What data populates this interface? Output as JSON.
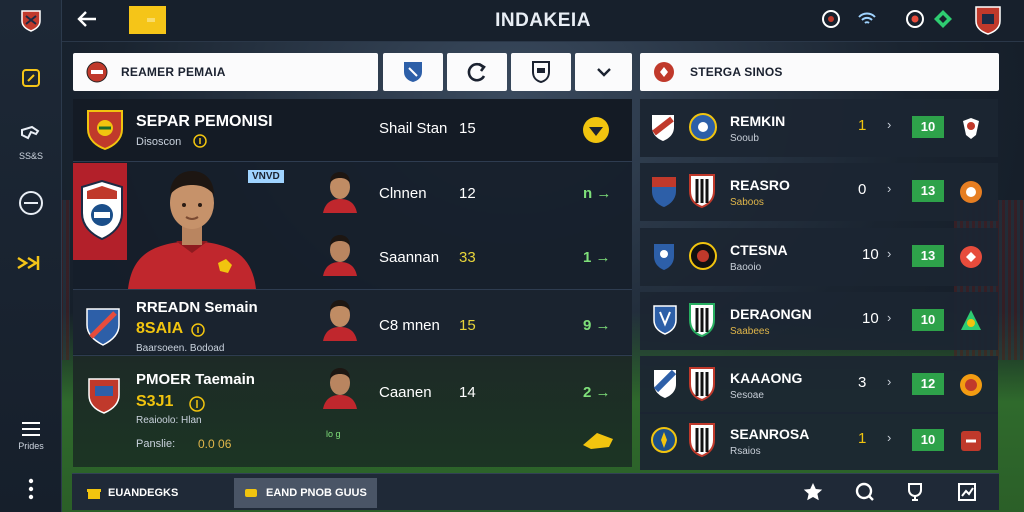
{
  "header": {
    "title": "INDAKEIA"
  },
  "rail": {
    "items": [
      {
        "label": ""
      },
      {
        "label": "SS&S"
      },
      {
        "label": ""
      },
      {
        "label": ""
      },
      {
        "label": "Prides"
      }
    ]
  },
  "filters": {
    "team_label": "REAMER PEMAIA",
    "right_label": "STERGA SINOS"
  },
  "squad": {
    "lead": {
      "name": "SEPAR PEMONISI",
      "sub": "Disoscon",
      "stat_name": "Shail Stan",
      "stat_value": "15"
    },
    "tag": "VNVD",
    "rows": [
      {
        "stat_name": "Clnnen",
        "value": "12",
        "trend": "n →",
        "value_yellow": false
      },
      {
        "stat_name": "Saannan",
        "value": "33",
        "trend": "1 →",
        "value_yellow": true
      },
      {
        "stat_name": "C8 mnen",
        "value": "15",
        "trend": "9 →",
        "value_yellow": true
      },
      {
        "stat_name": "Caanen",
        "value": "14",
        "trend": "2 →",
        "value_yellow": false
      }
    ],
    "p2": {
      "name": "RREADN Semain",
      "code": "8SAIA",
      "sub": "Baarsoeen. Bodoad"
    },
    "p3": {
      "name": "PMOER Taemain",
      "code": "S3J1",
      "sub": "Reaioolo: Hlan",
      "extra_label": "Panslie:",
      "extra_value": "0.0 06"
    },
    "mini_mark": "lo g"
  },
  "league": {
    "rows": [
      {
        "name": "REMKIN",
        "sub": "Sooub",
        "rank": "1",
        "pill": "10",
        "sub_yellow": false,
        "rank_color": "#f1c40f"
      },
      {
        "name": "REASRO",
        "sub": "Saboos",
        "rank": "0",
        "pill": "13",
        "sub_yellow": true,
        "rank_color": "#ffffff"
      },
      {
        "name": "CTESNA",
        "sub": "Baooio",
        "rank": "10",
        "pill": "13",
        "sub_yellow": false,
        "rank_color": "#ffffff"
      },
      {
        "name": "DERAONGN",
        "sub": "Saabees",
        "rank": "10",
        "pill": "10",
        "sub_yellow": true,
        "rank_color": "#ffffff"
      },
      {
        "name": "KAAAONG",
        "sub": "Sesoae",
        "rank": "3",
        "pill": "12",
        "sub_yellow": false,
        "rank_color": "#ffffff"
      },
      {
        "name": "SEANROSA",
        "sub": "Rsaios",
        "rank": "1",
        "pill": "10",
        "sub_yellow": false,
        "rank_color": "#f1c40f"
      }
    ]
  },
  "bottom": {
    "tab1": "EUANDEGKS",
    "tab2": "EAND PNOB GUUS"
  },
  "colors": {
    "accent_yellow": "#f5c518",
    "pill_green": "#2ea24a",
    "trend_green": "#7fe07a"
  },
  "icons": {
    "back": "arrow-left-icon",
    "top_right": [
      "refresh-icon",
      "signal-icon",
      "alert-icon",
      "diamond-icon",
      "club-crest-icon"
    ]
  }
}
